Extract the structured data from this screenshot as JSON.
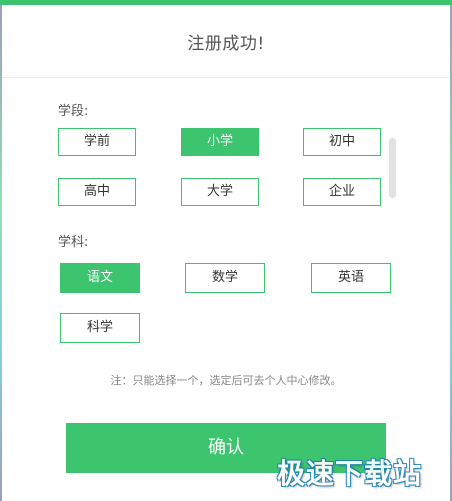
{
  "dialog": {
    "title": "注册成功!"
  },
  "stage": {
    "label": "学段:",
    "options": [
      "学前",
      "小学",
      "初中",
      "高中",
      "大学",
      "企业"
    ],
    "selected": "小学"
  },
  "subject": {
    "label": "学科:",
    "options": [
      "语文",
      "数学",
      "英语",
      "科学"
    ],
    "selected": "语文"
  },
  "note": "注：只能选择一个，选定后可去个人中心修改。",
  "confirm_label": "确认",
  "watermark": "极速下载站",
  "colors": {
    "accent": "#3cc46e",
    "text": "#333333",
    "muted": "#888888"
  }
}
